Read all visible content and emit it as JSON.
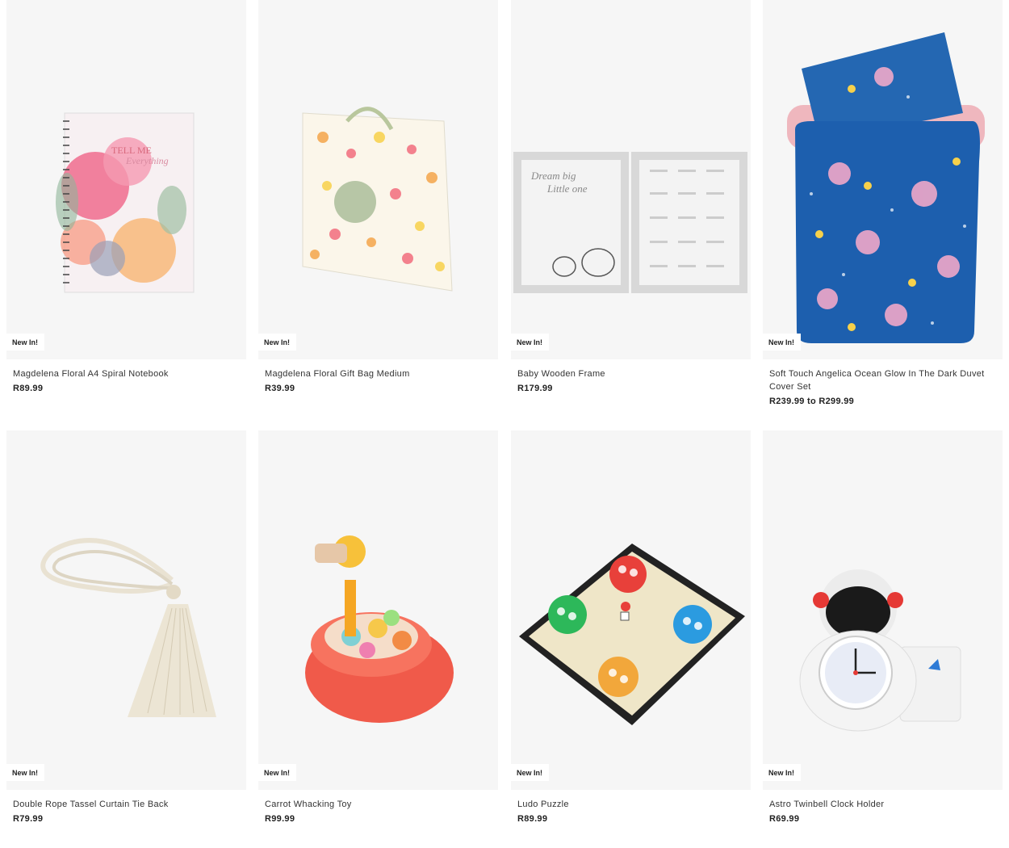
{
  "products": [
    {
      "badge": "New In!",
      "name": "Magdelena Floral A4 Spiral Notebook",
      "price": "R89.99",
      "image": "floral-notebook",
      "cover_text": [
        "TELL ME",
        "Everything"
      ]
    },
    {
      "badge": "New In!",
      "name": "Magdelena Floral Gift Bag Medium",
      "price": "R39.99",
      "image": "floral-gift-bag"
    },
    {
      "badge": "New In!",
      "name": "Baby Wooden Frame",
      "price": "R179.99",
      "image": "baby-frame",
      "frame_text": [
        "Dream big",
        "Little one"
      ]
    },
    {
      "badge": "New In!",
      "name": "Soft Touch Angelica Ocean Glow In The Dark Duvet Cover Set",
      "price": "R239.99 to R299.99",
      "image": "ocean-duvet"
    },
    {
      "badge": "New In!",
      "name": "Double Rope Tassel Curtain Tie Back",
      "price": "R79.99",
      "image": "rope-tassel"
    },
    {
      "badge": "New In!",
      "name": "Carrot Whacking Toy",
      "price": "R99.99",
      "image": "whacking-toy"
    },
    {
      "badge": "New In!",
      "name": "Ludo Puzzle",
      "price": "R89.99",
      "image": "ludo-board"
    },
    {
      "badge": "New In!",
      "name": "Astro Twinbell Clock Holder",
      "price": "R69.99",
      "image": "astronaut-clock"
    }
  ]
}
